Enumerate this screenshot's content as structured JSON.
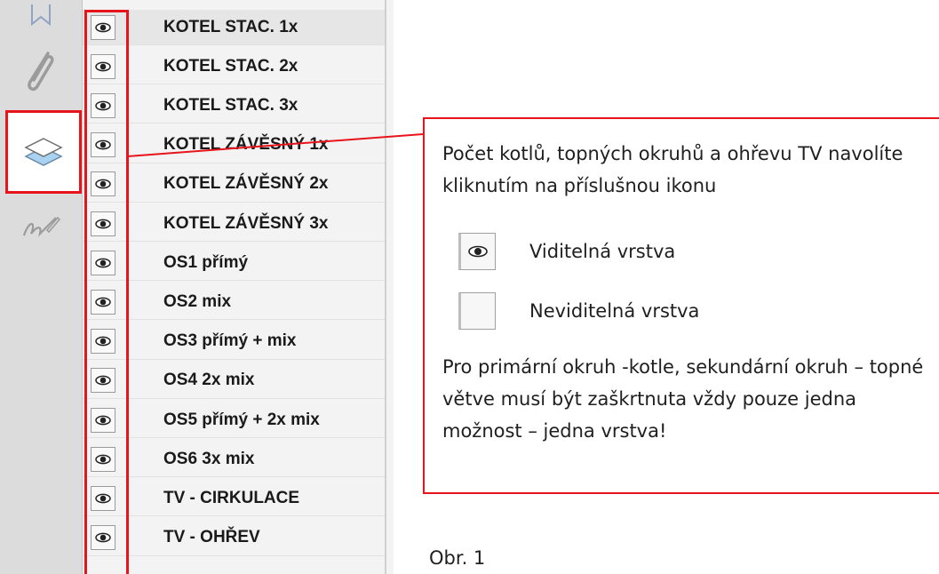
{
  "layers": [
    {
      "name": "KOTEL STAC. 1x",
      "visible": true,
      "selected": true
    },
    {
      "name": "KOTEL STAC. 2x",
      "visible": true
    },
    {
      "name": "KOTEL STAC. 3x",
      "visible": true
    },
    {
      "name": "KOTEL ZÁVĚSNÝ 1x",
      "visible": true
    },
    {
      "name": "KOTEL ZÁVĚSNÝ 2x",
      "visible": true
    },
    {
      "name": "KOTEL ZÁVĚSNÝ 3x",
      "visible": true
    },
    {
      "name": "OS1 přímý",
      "visible": true
    },
    {
      "name": "OS2 mix",
      "visible": true
    },
    {
      "name": "OS3 přímý + mix",
      "visible": true
    },
    {
      "name": "OS4 2x mix",
      "visible": true
    },
    {
      "name": "OS5 přímý + 2x mix",
      "visible": true
    },
    {
      "name": "OS6 3x mix",
      "visible": true
    },
    {
      "name": "TV - CIRKULACE",
      "visible": true
    },
    {
      "name": "TV - OHŘEV",
      "visible": true
    }
  ],
  "callout": {
    "intro": "Počet kotlů, topných okruhů a ohřevu TV navolíte kliknutím na příslušnou ikonu",
    "legend_visible": "Viditelná vrstva",
    "legend_hidden": "Neviditelná vrstva",
    "rule": "Pro primární okruh -kotle, sekundární okruh – topné větve musí být zaškrtnuta vždy pouze jedna možnost – jedna vrstva!"
  },
  "caption": "Obr. 1",
  "colors": {
    "highlight": "#e8141b",
    "rail": "#dcdcdc",
    "panel": "#f3f3f3"
  },
  "icons": {
    "rail": [
      "bookmark-icon",
      "paperclip-icon",
      "layers-icon",
      "signature-icon"
    ],
    "layer_toggle": "eye-icon"
  }
}
